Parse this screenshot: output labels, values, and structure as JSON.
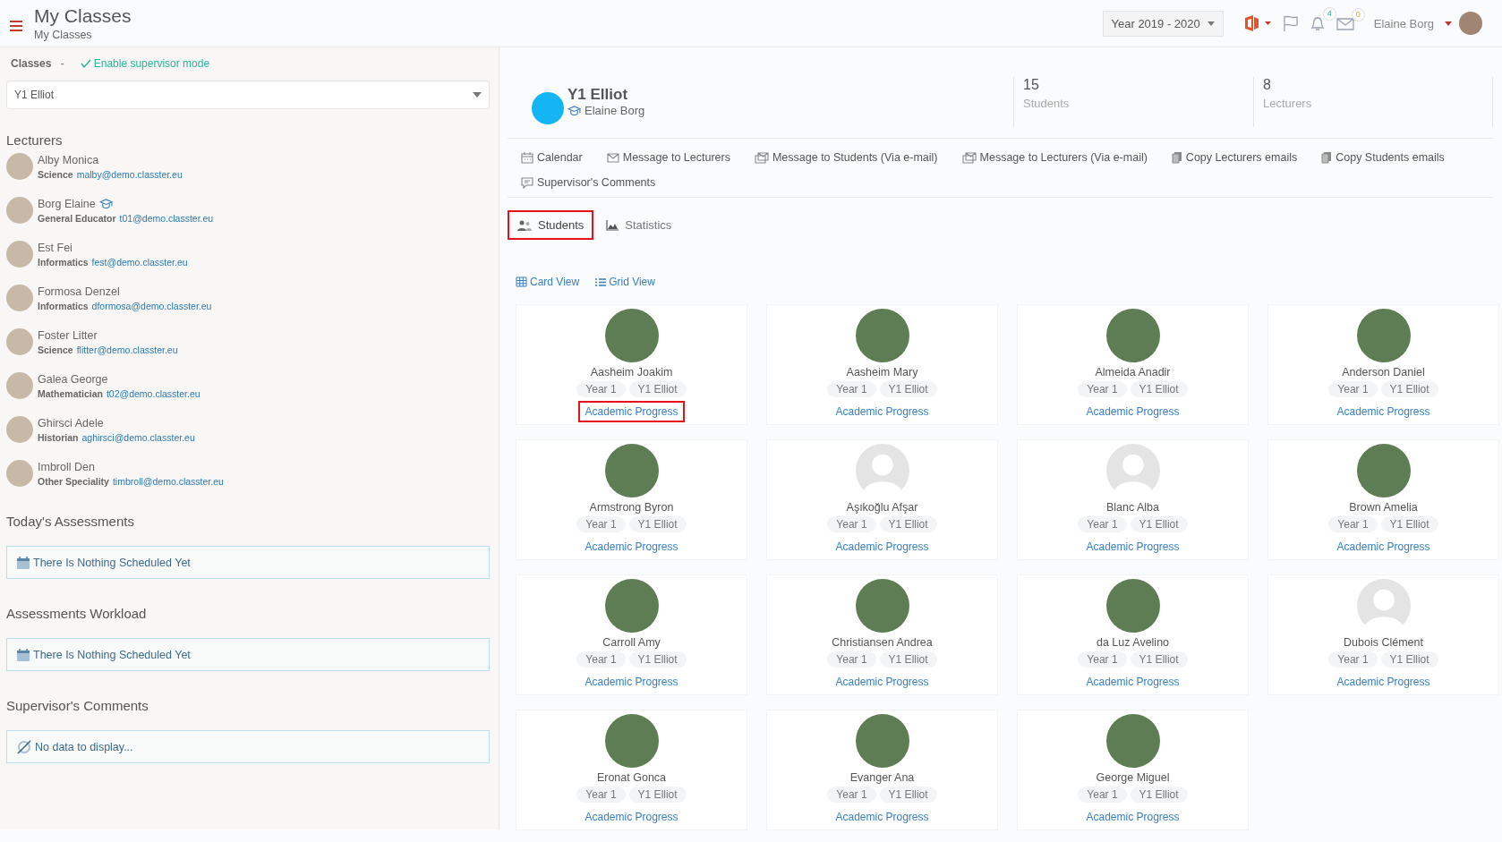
{
  "header": {
    "title": "My Classes",
    "breadcrumb": "My Classes",
    "year": "Year 2019 - 2020",
    "notifications": "4",
    "messages": "0",
    "user": "Elaine Borg"
  },
  "sidebar": {
    "classes_label": "Classes",
    "separator": "-",
    "supervisor_link": "Enable supervisor mode",
    "class_select": "Y1 Elliot",
    "lecturers_title": "Lecturers",
    "lecturers": [
      {
        "name": "Alby Monica",
        "role": "Science",
        "email": "malby@demo.classter.eu",
        "head": false
      },
      {
        "name": "Borg Elaine",
        "role": "General Educator",
        "email": "t01@demo.classter.eu",
        "head": true
      },
      {
        "name": "Est Fei",
        "role": "Informatics",
        "email": "fest@demo.classter.eu",
        "head": false
      },
      {
        "name": "Formosa Denzel",
        "role": "Informatics",
        "email": "dformosa@demo.classter.eu",
        "head": false
      },
      {
        "name": "Foster Litter",
        "role": "Science",
        "email": "flitter@demo.classter.eu",
        "head": false
      },
      {
        "name": "Galea George",
        "role": "Mathematician",
        "email": "t02@demo.classter.eu",
        "head": false
      },
      {
        "name": "Ghirsci Adele",
        "role": "Historian",
        "email": "aghirsci@demo.classter.eu",
        "head": false
      },
      {
        "name": "Imbroll Den",
        "role": "Other Speciality",
        "email": "timbroll@demo.classter.eu",
        "head": false
      }
    ],
    "panels": [
      {
        "title": "Today's Assessments",
        "message": "There Is Nothing Scheduled Yet",
        "kind": "calendar"
      },
      {
        "title": "Assessments Workload",
        "message": "There Is Nothing Scheduled Yet",
        "kind": "calendar"
      },
      {
        "title": "Supervisor's Comments",
        "message": "No data to display...",
        "kind": "empty"
      }
    ]
  },
  "class": {
    "name": "Y1 Elliot",
    "teacher": "Elaine Borg",
    "stats": [
      {
        "value": "15",
        "label": "Students"
      },
      {
        "value": "8",
        "label": "Lecturers"
      }
    ]
  },
  "actions": [
    {
      "label": "Calendar",
      "kind": "calendar"
    },
    {
      "label": "Message to Lecturers",
      "kind": "mail"
    },
    {
      "label": "Message to Students (Via e-mail)",
      "kind": "mails"
    },
    {
      "label": "Message to Lecturers (Via e-mail)",
      "kind": "mails"
    },
    {
      "label": "Copy Lecturers emails",
      "kind": "copy"
    },
    {
      "label": "Copy Students emails",
      "kind": "copy"
    },
    {
      "label": "Supervisor's Comments",
      "kind": "comment"
    }
  ],
  "tabs": [
    {
      "label": "Students",
      "kind": "users",
      "selected": true,
      "highlighted": true
    },
    {
      "label": "Statistics",
      "kind": "chart",
      "selected": false,
      "highlighted": false
    }
  ],
  "views": [
    {
      "label": "Card View",
      "kind": "table"
    },
    {
      "label": "Grid View",
      "kind": "list"
    }
  ],
  "students": [
    {
      "name": "Aasheim Joakim",
      "year": "Year 1",
      "class": "Y1 Elliot",
      "link": "Academic Progress",
      "kind": "photo",
      "highlighted": true
    },
    {
      "name": "Aasheim Mary",
      "year": "Year 1",
      "class": "Y1 Elliot",
      "link": "Academic Progress",
      "kind": "photo",
      "highlighted": false
    },
    {
      "name": "Almeida Anadir",
      "year": "Year 1",
      "class": "Y1 Elliot",
      "link": "Academic Progress",
      "kind": "photo",
      "highlighted": false
    },
    {
      "name": "Anderson Daniel",
      "year": "Year 1",
      "class": "Y1 Elliot",
      "link": "Academic Progress",
      "kind": "photo",
      "highlighted": false
    },
    {
      "name": "Armstrong Byron",
      "year": "Year 1",
      "class": "Y1 Elliot",
      "link": "Academic Progress",
      "kind": "photo",
      "highlighted": false
    },
    {
      "name": "Aşıkoğlu Afşar",
      "year": "Year 1",
      "class": "Y1 Elliot",
      "link": "Academic Progress",
      "kind": "silhouette",
      "highlighted": false
    },
    {
      "name": "Blanc Alba",
      "year": "Year 1",
      "class": "Y1 Elliot",
      "link": "Academic Progress",
      "kind": "silhouette",
      "highlighted": false
    },
    {
      "name": "Brown Amelia",
      "year": "Year 1",
      "class": "Y1 Elliot",
      "link": "Academic Progress",
      "kind": "photo",
      "highlighted": false
    },
    {
      "name": "Carroll Amy",
      "year": "Year 1",
      "class": "Y1 Elliot",
      "link": "Academic Progress",
      "kind": "photo",
      "highlighted": false
    },
    {
      "name": "Christiansen Andrea",
      "year": "Year 1",
      "class": "Y1 Elliot",
      "link": "Academic Progress",
      "kind": "photo",
      "highlighted": false
    },
    {
      "name": "da Luz Avelino",
      "year": "Year 1",
      "class": "Y1 Elliot",
      "link": "Academic Progress",
      "kind": "photo",
      "highlighted": false
    },
    {
      "name": "Dubois Clément",
      "year": "Year 1",
      "class": "Y1 Elliot",
      "link": "Academic Progress",
      "kind": "silhouette",
      "highlighted": false
    },
    {
      "name": "Eronat Gonca",
      "year": "Year 1",
      "class": "Y1 Elliot",
      "link": "Academic Progress",
      "kind": "photo",
      "highlighted": false
    },
    {
      "name": "Evanger Ana",
      "year": "Year 1",
      "class": "Y1 Elliot",
      "link": "Academic Progress",
      "kind": "photo",
      "highlighted": false
    },
    {
      "name": "George Miguel",
      "year": "Year 1",
      "class": "Y1 Elliot",
      "link": "Academic Progress",
      "kind": "photo",
      "highlighted": false
    }
  ]
}
